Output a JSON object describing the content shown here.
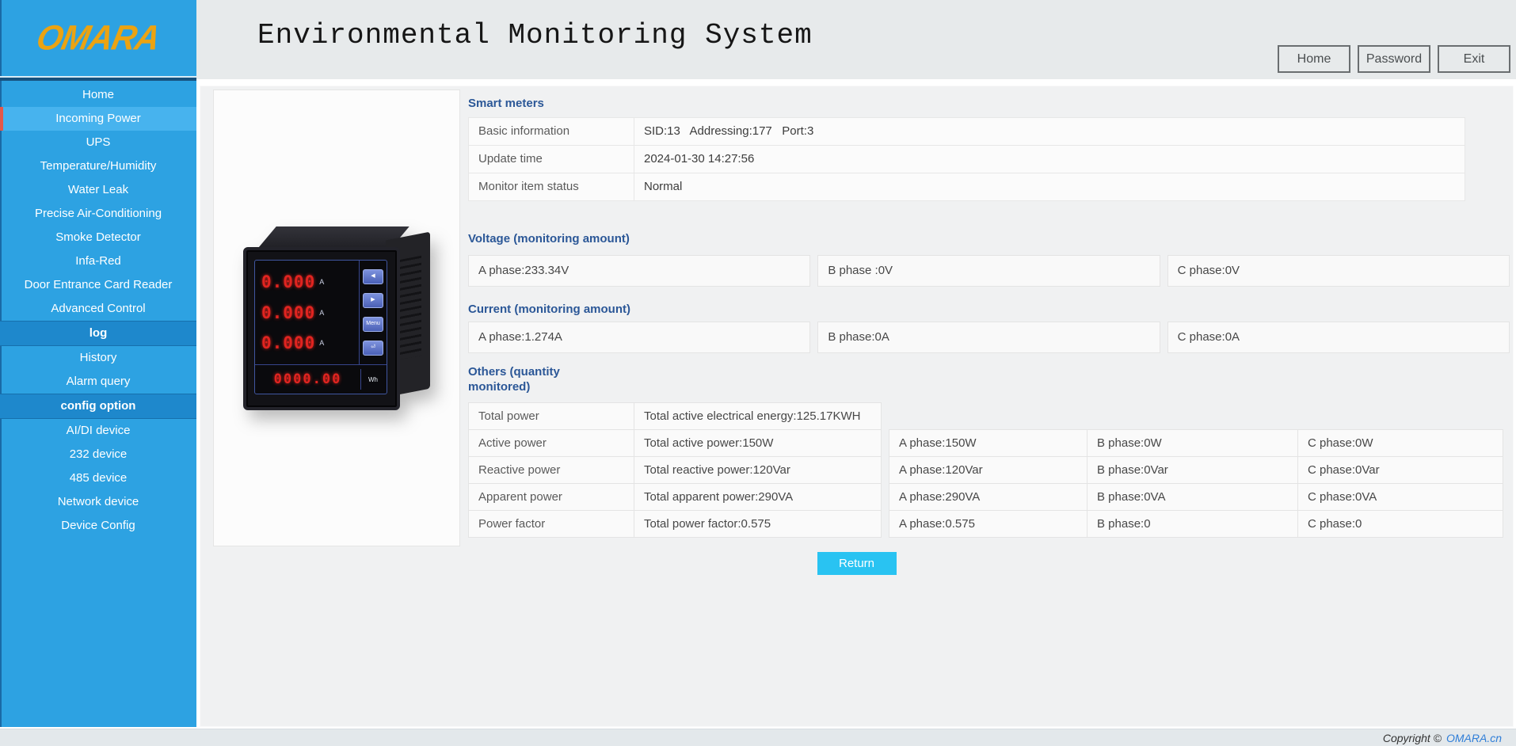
{
  "app": {
    "title": "Environmental Monitoring System"
  },
  "sidebar": {
    "logo": "OMARA",
    "items": [
      {
        "label": "Home",
        "type": "item"
      },
      {
        "label": "Incoming Power",
        "type": "active"
      },
      {
        "label": "UPS",
        "type": "item"
      },
      {
        "label": "Temperature/Humidity",
        "type": "item"
      },
      {
        "label": "Water Leak",
        "type": "item"
      },
      {
        "label": "Precise Air-Conditioning",
        "type": "item"
      },
      {
        "label": "Smoke Detector",
        "type": "item"
      },
      {
        "label": "Infa-Red",
        "type": "item"
      },
      {
        "label": "Door Entrance Card Reader",
        "type": "item"
      },
      {
        "label": "Advanced Control",
        "type": "item"
      },
      {
        "label": "log",
        "type": "header"
      },
      {
        "label": "History",
        "type": "item"
      },
      {
        "label": "Alarm query",
        "type": "item"
      },
      {
        "label": "config option",
        "type": "header"
      },
      {
        "label": "AI/DI device",
        "type": "item"
      },
      {
        "label": "232 device",
        "type": "item"
      },
      {
        "label": "485 device",
        "type": "item"
      },
      {
        "label": "Network device",
        "type": "item"
      },
      {
        "label": "Device Config",
        "type": "item"
      }
    ]
  },
  "header": {
    "buttons": [
      {
        "label": "Home"
      },
      {
        "label": "Password"
      },
      {
        "label": "Exit"
      }
    ]
  },
  "device": {
    "display_rows": [
      "0.000",
      "0.000",
      "0.000"
    ],
    "row_unit": "A",
    "bottom_display": "0000.00",
    "buttons": [
      "◀",
      "▶",
      "Menu",
      "⏎"
    ],
    "energy_label": "Wh"
  },
  "main": {
    "smart": {
      "title": "Smart meters",
      "rows": [
        {
          "label": "Basic information",
          "value": "SID:13   Addressing:177   Port:3"
        },
        {
          "label": "Update time",
          "value": "2024-01-30 14:27:56"
        },
        {
          "label": "Monitor item status",
          "value": "Normal",
          "status": true
        }
      ]
    },
    "voltage": {
      "title": "Voltage (monitoring amount)",
      "cells": [
        "A phase:233.34V",
        "B phase :0V",
        "C phase:0V"
      ]
    },
    "current": {
      "title": "Current (monitoring amount)",
      "cells": [
        "A phase:1.274A",
        "B phase:0A",
        "C phase:0A"
      ]
    },
    "others": {
      "title": "Others (quantity monitored)",
      "rows": [
        [
          "Total power",
          "Total active electrical energy:125.17KWH"
        ],
        [
          "Active power",
          "Total active power:150W",
          "A phase:150W",
          "B phase:0W",
          "C phase:0W"
        ],
        [
          "Reactive power",
          "Total reactive power:120Var",
          "A phase:120Var",
          "B phase:0Var",
          "C phase:0Var"
        ],
        [
          "Apparent power",
          "Total apparent power:290VA",
          "A phase:290VA",
          "B phase:0VA",
          "C phase:0VA"
        ],
        [
          "Power factor",
          "Total power factor:0.575",
          "A phase:0.575",
          "B phase:0",
          "C phase:0"
        ]
      ]
    },
    "return_label": "Return"
  },
  "footer": {
    "copyright": "Copyright ©",
    "link": "OMARA.cn"
  },
  "colors": {
    "sidebar_blue": "#2da2e2",
    "sidebar_active": "#47b3ee",
    "active_accent_red": "#e4584a",
    "menu_header_blue": "#1e88cc",
    "section_title_blue": "#2b5797",
    "status_green": "#1ca22a",
    "return_cyan": "#29c3f2",
    "logo_orange": "#eba312",
    "footer_link_blue": "#2f7ed8"
  }
}
